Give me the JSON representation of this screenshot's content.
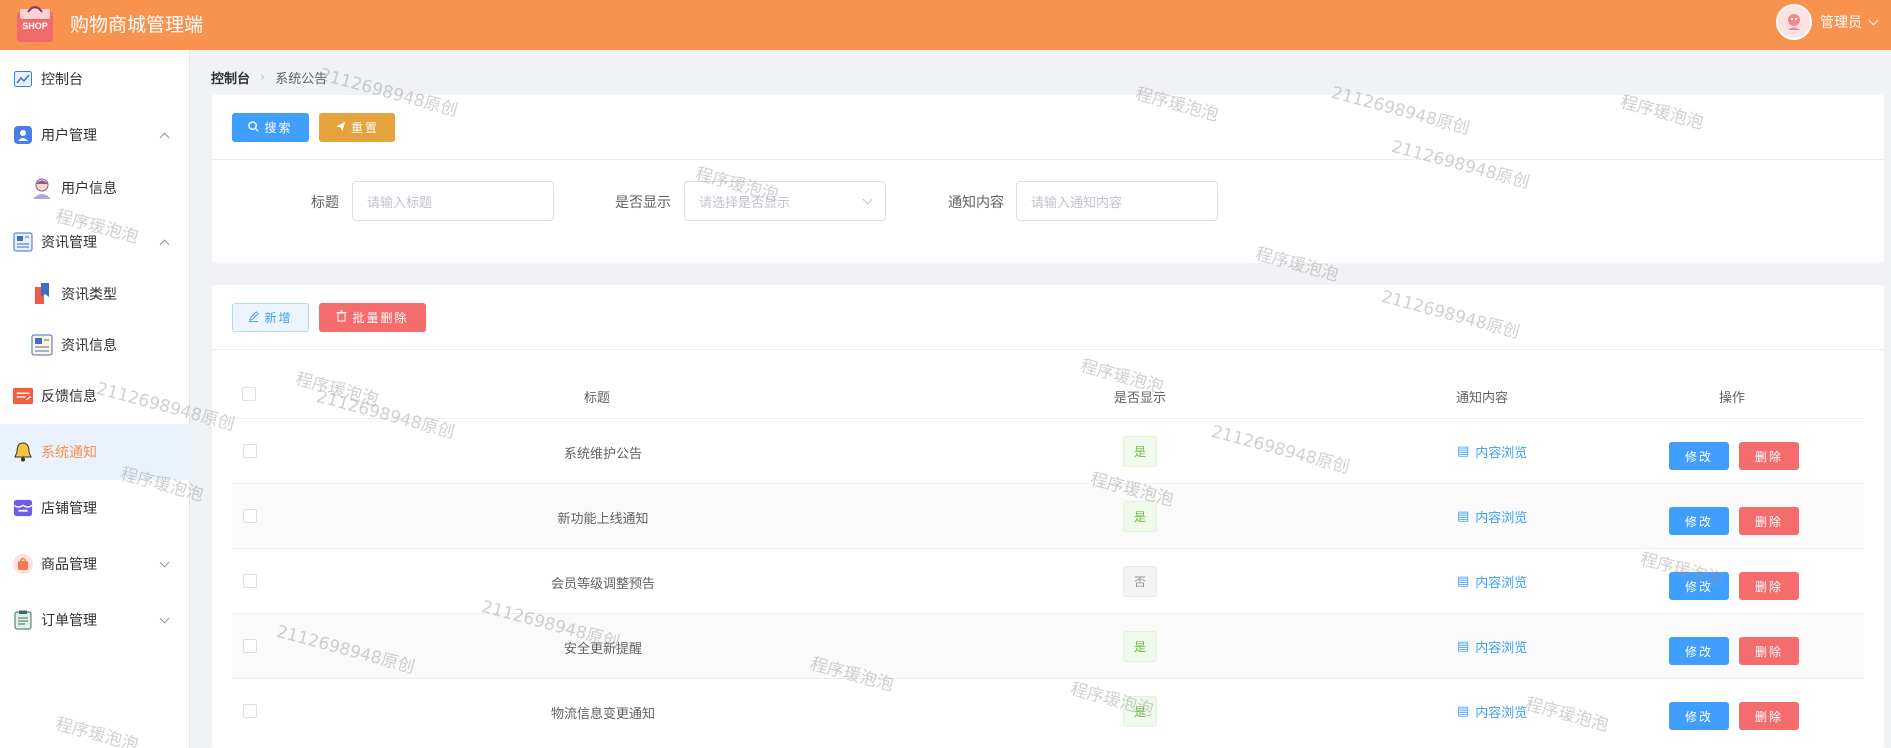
{
  "header": {
    "logo_text": "SHOP",
    "app_title": "购物商城管理端",
    "user_name": "管理员"
  },
  "sidebar": {
    "items": [
      {
        "label": "控制台",
        "icon": "chart-line-icon"
      },
      {
        "label": "用户管理",
        "icon": "user-group-icon",
        "expanded": true
      },
      {
        "label": "用户信息",
        "icon": "user-avatar-icon"
      },
      {
        "label": "资讯管理",
        "icon": "newspaper-icon",
        "expanded": true
      },
      {
        "label": "资讯类型",
        "icon": "bookmark-icon"
      },
      {
        "label": "资讯信息",
        "icon": "news-doc-icon"
      },
      {
        "label": "反馈信息",
        "icon": "feedback-icon"
      },
      {
        "label": "系统通知",
        "icon": "bell-icon",
        "active": true
      },
      {
        "label": "店铺管理",
        "icon": "store-icon"
      },
      {
        "label": "商品管理",
        "icon": "shopping-bag-icon"
      },
      {
        "label": "订单管理",
        "icon": "clipboard-icon"
      }
    ]
  },
  "breadcrumb": {
    "home": "控制台",
    "current": "系统公告"
  },
  "search": {
    "search_button": "搜索",
    "reset_button": "重置",
    "title_label": "标题",
    "title_placeholder": "请输入标题",
    "display_label": "是否显示",
    "display_placeholder": "请选择是否显示",
    "content_label": "通知内容",
    "content_placeholder": "请输入通知内容"
  },
  "toolbar": {
    "add_button": "新增",
    "batch_delete_button": "批量删除"
  },
  "table": {
    "headers": {
      "title": "标题",
      "display": "是否显示",
      "content": "通知内容",
      "actions": "操作"
    },
    "rows": [
      {
        "title": "系统维护公告",
        "display": "是",
        "content_link": "内容浏览",
        "edit": "修改",
        "delete": "删除"
      },
      {
        "title": "新功能上线通知",
        "display": "是",
        "content_link": "内容浏览",
        "edit": "修改",
        "delete": "删除"
      },
      {
        "title": "会员等级调整预告",
        "display": "否",
        "content_link": "内容浏览",
        "edit": "修改",
        "delete": "删除"
      },
      {
        "title": "安全更新提醒",
        "display": "是",
        "content_link": "内容浏览",
        "edit": "修改",
        "delete": "删除"
      },
      {
        "title": "物流信息变更通知",
        "display": "是",
        "content_link": "内容浏览",
        "edit": "修改",
        "delete": "删除"
      }
    ]
  },
  "watermarks": {
    "id_text": "2112698948原创",
    "brand_text": "程序瑗泡泡"
  },
  "colors": {
    "header_bg": "#f9914f",
    "primary": "#409eff",
    "warning": "#e6a23c",
    "danger": "#f56c6c",
    "success": "#67c23a"
  }
}
